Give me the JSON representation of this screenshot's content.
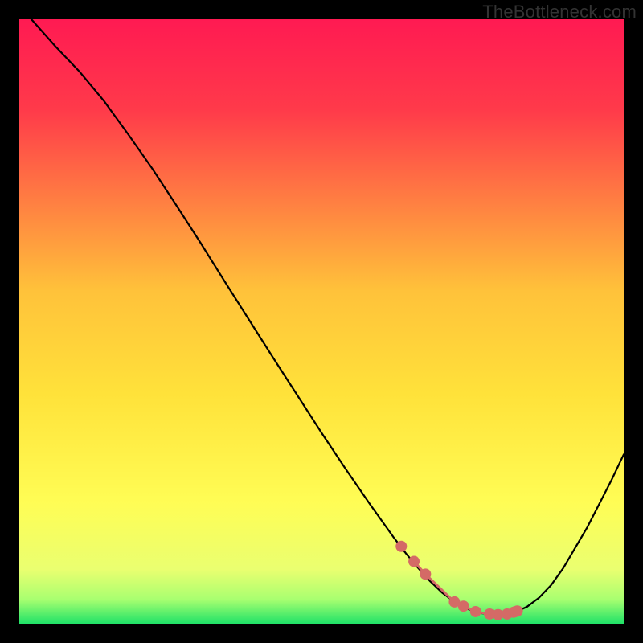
{
  "watermark": "TheBottleneck.com",
  "chart_data": {
    "type": "line",
    "title": "",
    "xlabel": "",
    "ylabel": "",
    "xlim": [
      0,
      100
    ],
    "ylim": [
      0,
      100
    ],
    "background": {
      "type": "vertical-gradient",
      "stops": [
        {
          "offset": 0.0,
          "color": "#ff1a52"
        },
        {
          "offset": 0.15,
          "color": "#ff3a4a"
        },
        {
          "offset": 0.45,
          "color": "#ffc23a"
        },
        {
          "offset": 0.62,
          "color": "#ffe23a"
        },
        {
          "offset": 0.8,
          "color": "#fffd55"
        },
        {
          "offset": 0.91,
          "color": "#eaff70"
        },
        {
          "offset": 0.96,
          "color": "#a8ff70"
        },
        {
          "offset": 1.0,
          "color": "#20e268"
        }
      ]
    },
    "series": [
      {
        "name": "bottleneck-curve",
        "type": "line",
        "color": "#000000",
        "x": [
          2,
          6,
          10,
          14,
          18,
          22,
          26,
          30,
          34,
          38,
          42,
          46,
          50,
          54,
          58,
          62,
          64,
          66,
          68,
          70,
          72,
          74,
          76,
          78,
          80,
          82,
          84,
          86,
          88,
          90,
          94,
          98,
          100
        ],
        "y": [
          100,
          95.5,
          91.3,
          86.5,
          81,
          75.3,
          69.2,
          63,
          56.6,
          50.3,
          44,
          37.8,
          31.6,
          25.6,
          19.8,
          14.2,
          11.6,
          9.2,
          7.0,
          5.1,
          3.6,
          2.5,
          1.8,
          1.5,
          1.5,
          1.9,
          2.8,
          4.3,
          6.4,
          9.2,
          16.0,
          23.8,
          28.0
        ]
      },
      {
        "name": "sweet-spot-markers",
        "type": "scatter",
        "color": "#d46a66",
        "marker_size": 7,
        "x": [
          63.2,
          65.3,
          67.2,
          72.0,
          73.5,
          75.5,
          77.8,
          79.2,
          80.7,
          81.8,
          82.1,
          82.4
        ],
        "y": [
          12.8,
          10.3,
          8.2,
          3.6,
          2.9,
          2.0,
          1.6,
          1.5,
          1.6,
          1.9,
          2.0,
          2.1
        ]
      },
      {
        "name": "sweet-spot-line",
        "type": "line",
        "color": "#d46a66",
        "linewidth": 3,
        "x": [
          65.3,
          67.2,
          72.0,
          73.5,
          75.5,
          77.8,
          79.2,
          80.7,
          81.8
        ],
        "y": [
          10.3,
          8.2,
          3.6,
          2.9,
          2.0,
          1.6,
          1.5,
          1.6,
          1.9
        ]
      }
    ]
  }
}
